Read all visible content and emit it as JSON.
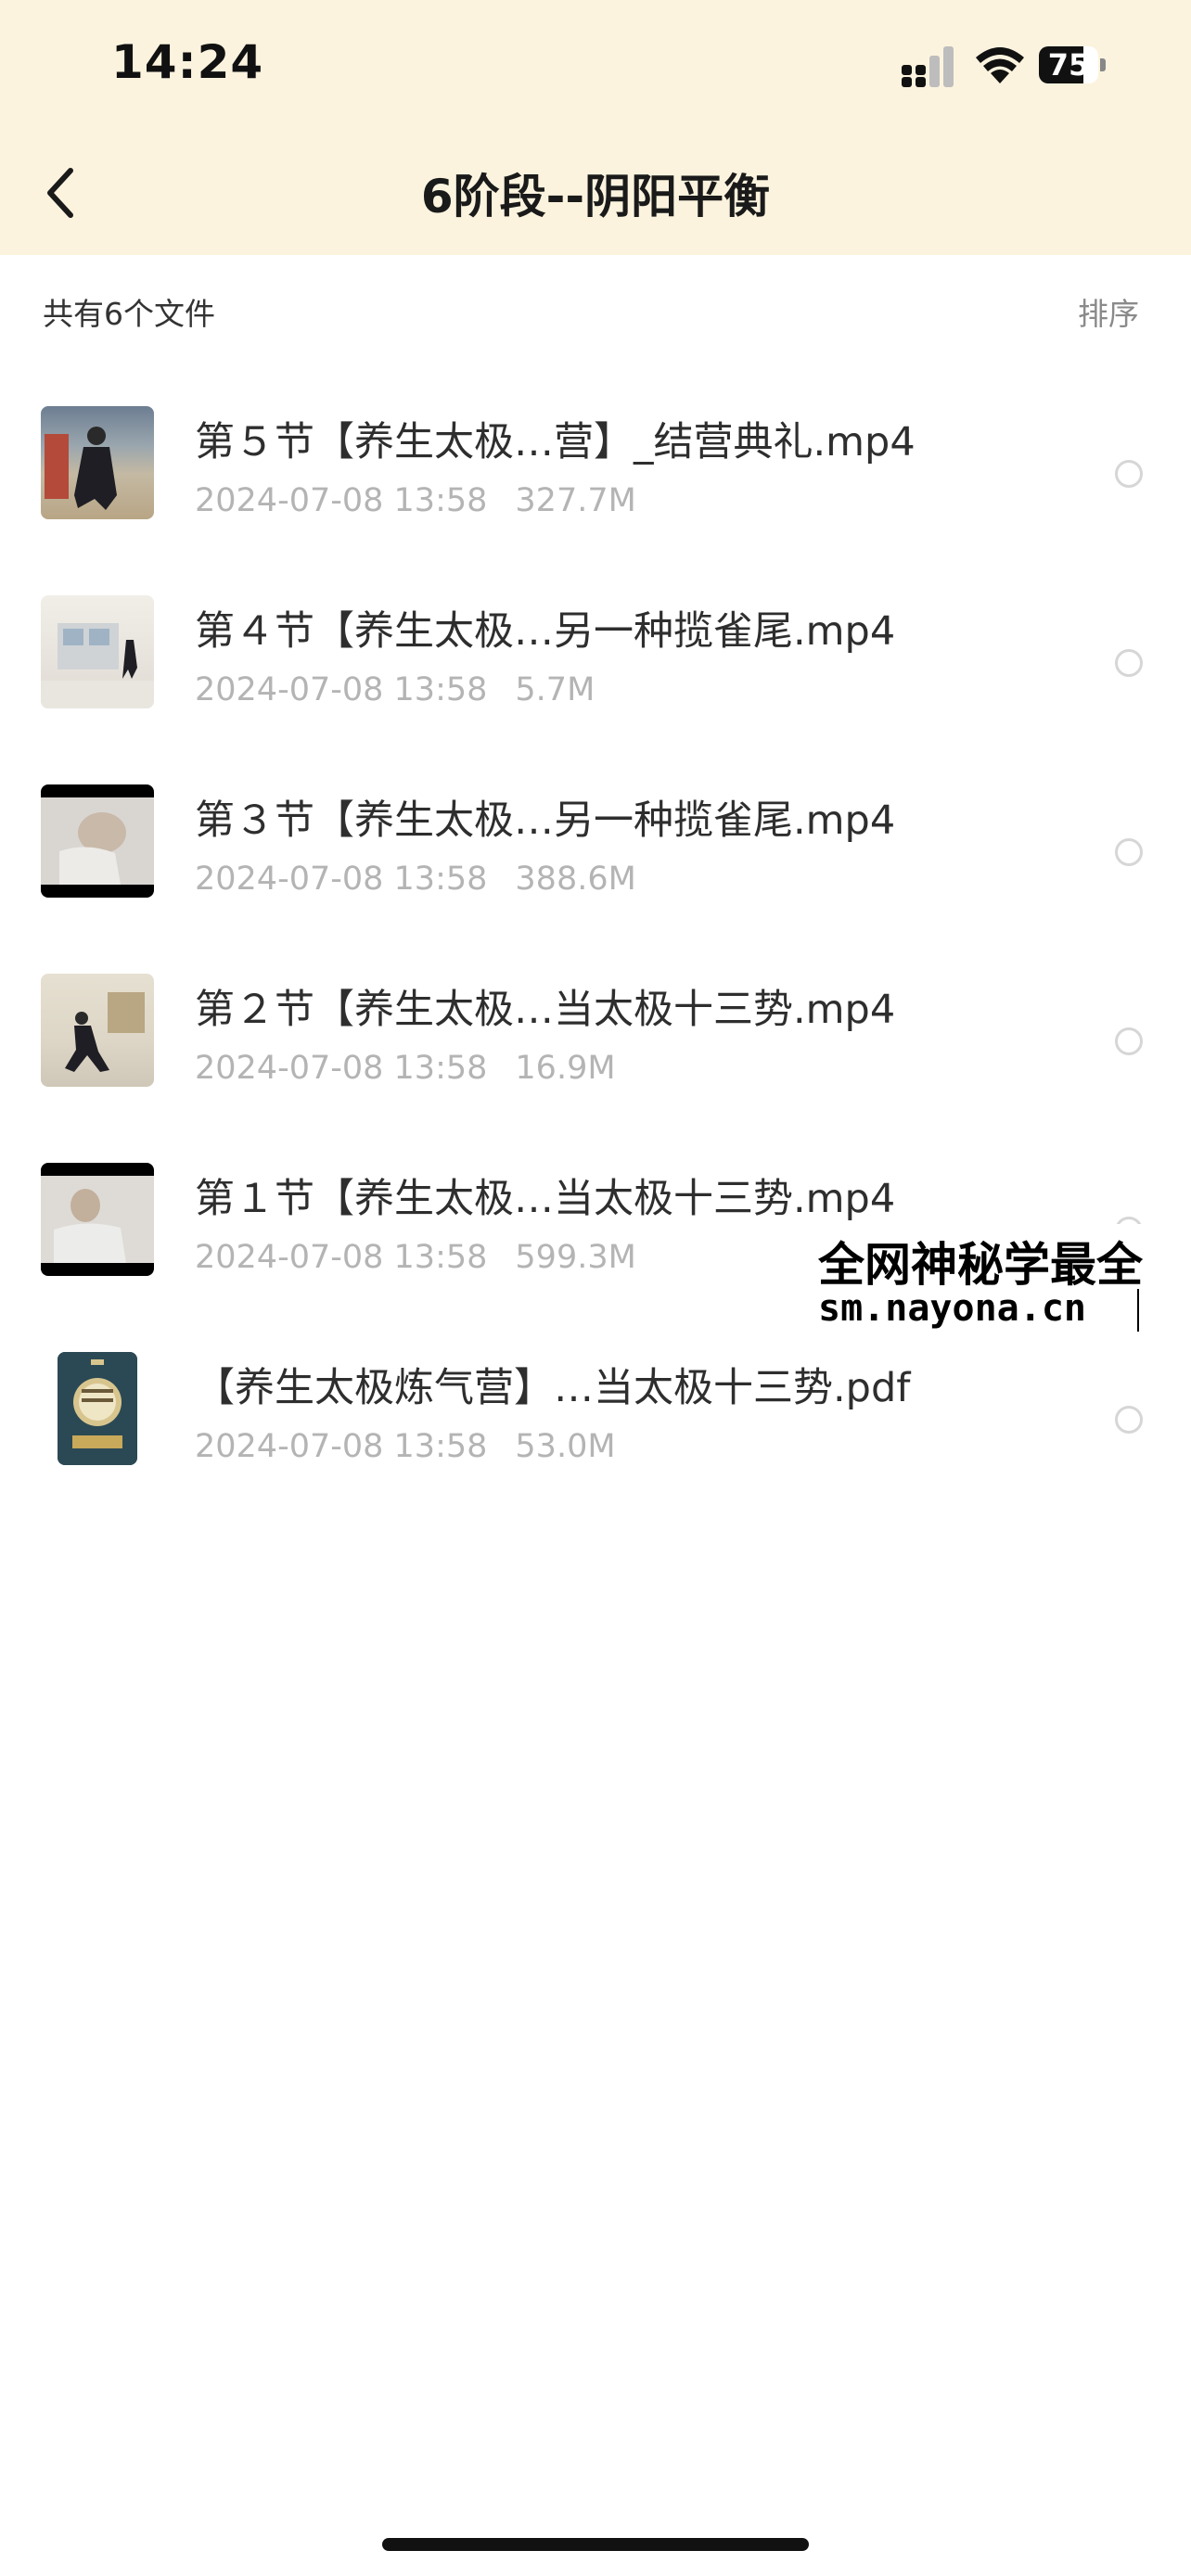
{
  "status_bar": {
    "time": "14:24",
    "battery_level": "75",
    "signal_icon": "cellular-signal-icon",
    "wifi_icon": "wifi-icon"
  },
  "nav": {
    "back_icon": "chevron-left-icon",
    "title": "6阶段--阴阳平衡"
  },
  "summary": {
    "file_count": "共有6个文件",
    "sort_label": "排序"
  },
  "files": [
    {
      "name": "第５节【养生太极…营】_结营典礼.mp4",
      "date": "2024-07-08 13:58",
      "size": "327.7M",
      "type": "video"
    },
    {
      "name": "第４节【养生太极…另一种揽雀尾.mp4",
      "date": "2024-07-08 13:58",
      "size": "5.7M",
      "type": "video"
    },
    {
      "name": "第３节【养生太极…另一种揽雀尾.mp4",
      "date": "2024-07-08 13:58",
      "size": "388.6M",
      "type": "video"
    },
    {
      "name": "第２节【养生太极…当太极十三势.mp4",
      "date": "2024-07-08 13:58",
      "size": "16.9M",
      "type": "video"
    },
    {
      "name": "第１节【养生太极…当太极十三势.mp4",
      "date": "2024-07-08 13:58",
      "size": "599.3M",
      "type": "video"
    },
    {
      "name": "【养生太极炼气营】…当太极十三势.pdf",
      "date": "2024-07-08 13:58",
      "size": "53.0M",
      "type": "pdf"
    }
  ],
  "watermark": {
    "line1": "全网神秘学最全",
    "line2": "sm.nayona.cn"
  }
}
